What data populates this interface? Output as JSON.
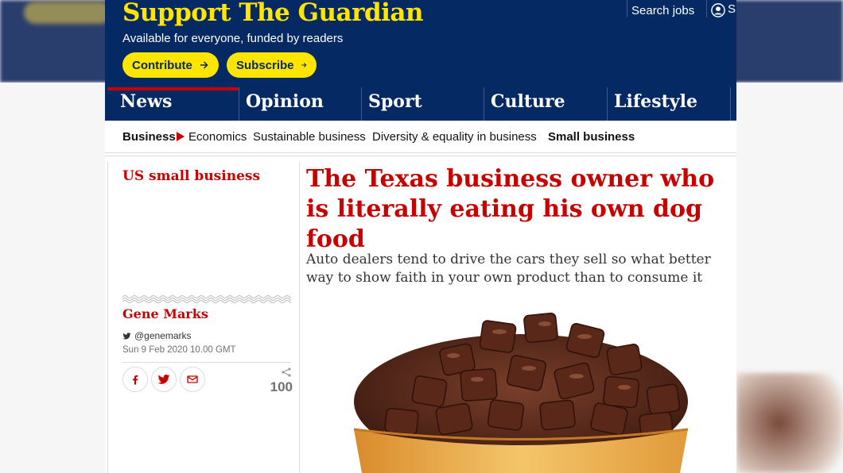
{
  "masthead": {
    "title": "Support The Guardian",
    "subtitle": "Available for everyone, funded by readers",
    "contribute_label": "Contribute",
    "subscribe_label": "Subscribe",
    "search_jobs_label": "Search jobs",
    "signin_label": "S"
  },
  "pillars": [
    {
      "label": "News",
      "active": true
    },
    {
      "label": "Opinion",
      "active": false
    },
    {
      "label": "Sport",
      "active": false
    },
    {
      "label": "Culture",
      "active": false
    },
    {
      "label": "Lifestyle",
      "active": false
    }
  ],
  "subnav": {
    "section": "Business",
    "items": [
      "Economics",
      "Sustainable business",
      "Diversity & equality in business"
    ],
    "current": "Small business"
  },
  "article": {
    "series": "US small business",
    "headline": "The Texas business owner who is literally eating his own dog food",
    "standfirst": "Auto dealers tend to drive the cars they sell so what better way to show faith in your own product than to consume it",
    "author": "Gene Marks",
    "twitter_handle": "@genemarks",
    "date": "Sun 9 Feb 2020 10.00 GMT",
    "share_count": "100"
  },
  "colors": {
    "brand_blue": "#052962",
    "brand_yellow": "#ffe500",
    "news_red": "#c70000"
  },
  "icons": {
    "arrow": "arrow-right-icon",
    "user": "user-icon",
    "twitter": "twitter-icon",
    "facebook": "facebook-icon",
    "email": "email-icon",
    "share": "share-icon"
  }
}
